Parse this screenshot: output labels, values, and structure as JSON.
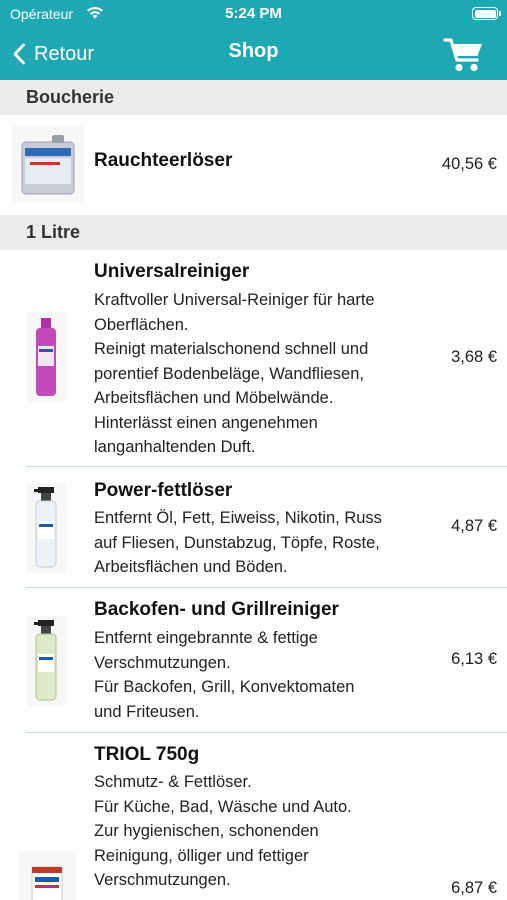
{
  "status": {
    "carrier": "Opérateur",
    "time": "5:24 PM"
  },
  "nav": {
    "back_label": "Retour",
    "title": "Shop",
    "cart_icon": "cart-icon"
  },
  "colors": {
    "accent": "#1fa8b4",
    "section_bg": "#ececec"
  },
  "sections": [
    {
      "title": "Boucherie",
      "items": [
        {
          "name": "Rauchteerlöser",
          "description": [],
          "price": "40,56 €"
        }
      ]
    },
    {
      "title": "1 Litre",
      "items": [
        {
          "name": "Universalreiniger",
          "description": [
            "Kraftvoller Universal-Reiniger für harte",
            "Oberflächen.",
            "Reinigt materialschonend schnell und",
            "porentief Bodenbeläge, Wandfliesen,",
            "Arbeitsflächen und Möbelwände.",
            "Hinterlässt einen angenehmen",
            "langanhaltenden Duft."
          ],
          "price": "3,68 €"
        },
        {
          "name": "Power-fettlöser",
          "description": [
            "Entfernt Öl, Fett, Eiweiss, Nikotin, Russ",
            "auf Fliesen, Dunstabzug, Töpfe, Roste,",
            "Arbeitsflächen und Böden."
          ],
          "price": "4,87 €"
        },
        {
          "name": "Backofen- und Grillreiniger",
          "description": [
            "Entfernt eingebrannte & fettige",
            "Verschmutzungen.",
            "Für Backofen, Grill, Konvektomaten",
            "und Friteusen."
          ],
          "price": "6,13 €"
        },
        {
          "name": "TRIOL 750g",
          "description": [
            "Schmutz- & Fettlöser.",
            "Für Küche, Bad, Wäsche und Auto.",
            "Zur hygienischen, schonenden",
            "Reinigung, ölliger und fettiger",
            "Verschmutzungen."
          ],
          "price": "6,87 €"
        }
      ]
    }
  ]
}
